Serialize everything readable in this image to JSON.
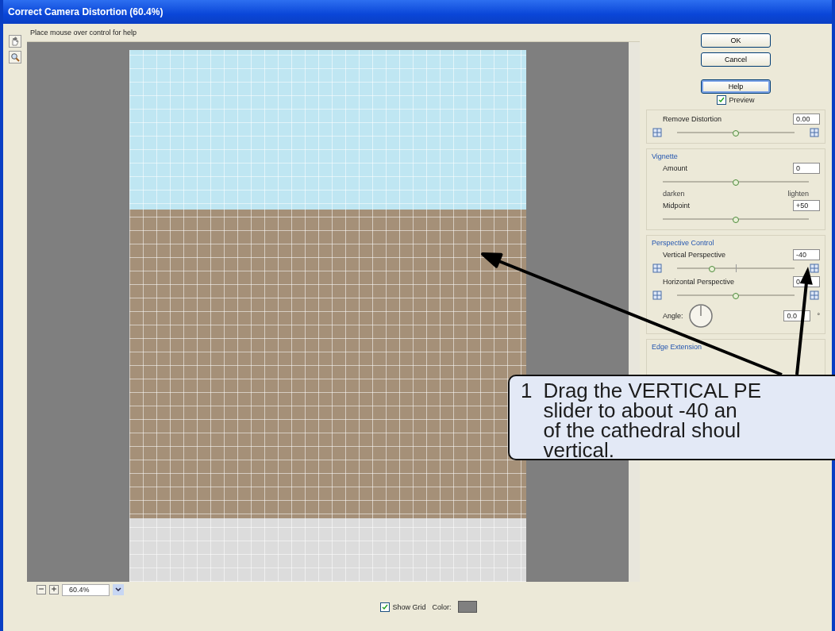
{
  "window": {
    "title": "Correct Camera Distortion (60.4%)"
  },
  "help_text": "Place mouse over control for help",
  "buttons": [
    {
      "label": "OK",
      "focused": false
    },
    {
      "label": "Cancel",
      "focused": false
    },
    {
      "label": "Help",
      "focused": true
    }
  ],
  "preview": {
    "label": "Preview",
    "checked": true
  },
  "remove_distortion": {
    "label": "Remove Distortion",
    "value": "0.00",
    "level": 0.5
  },
  "vignette": {
    "title": "Vignette",
    "amount": {
      "label": "Amount",
      "value": "0",
      "level": 0.5
    },
    "left": "darken",
    "right": "lighten",
    "midpoint": {
      "label": "Midpoint",
      "value": "+50",
      "level": 0.5
    }
  },
  "perspective": {
    "title": "Perspective Control",
    "vertical": {
      "label": "Vertical Perspective",
      "value": "-40",
      "level": 0.3
    },
    "horizontal": {
      "label": "Horizontal Perspective",
      "value": "0",
      "level": 0.5
    },
    "angle": {
      "label": "Angle:",
      "value": "0.0",
      "unit": "°"
    }
  },
  "edge_extension": {
    "title": "Edge Extension"
  },
  "zoom": {
    "value": "60.4%"
  },
  "show_grid": {
    "label": "Show Grid",
    "checked": true
  },
  "grid_color": {
    "label": "Color:",
    "color": "#808080"
  },
  "callout": {
    "number": "1",
    "lines": [
      "Drag the VERTICAL PE",
      "slider to about -40 an",
      "of the cathedral shoul",
      "vertical."
    ]
  }
}
